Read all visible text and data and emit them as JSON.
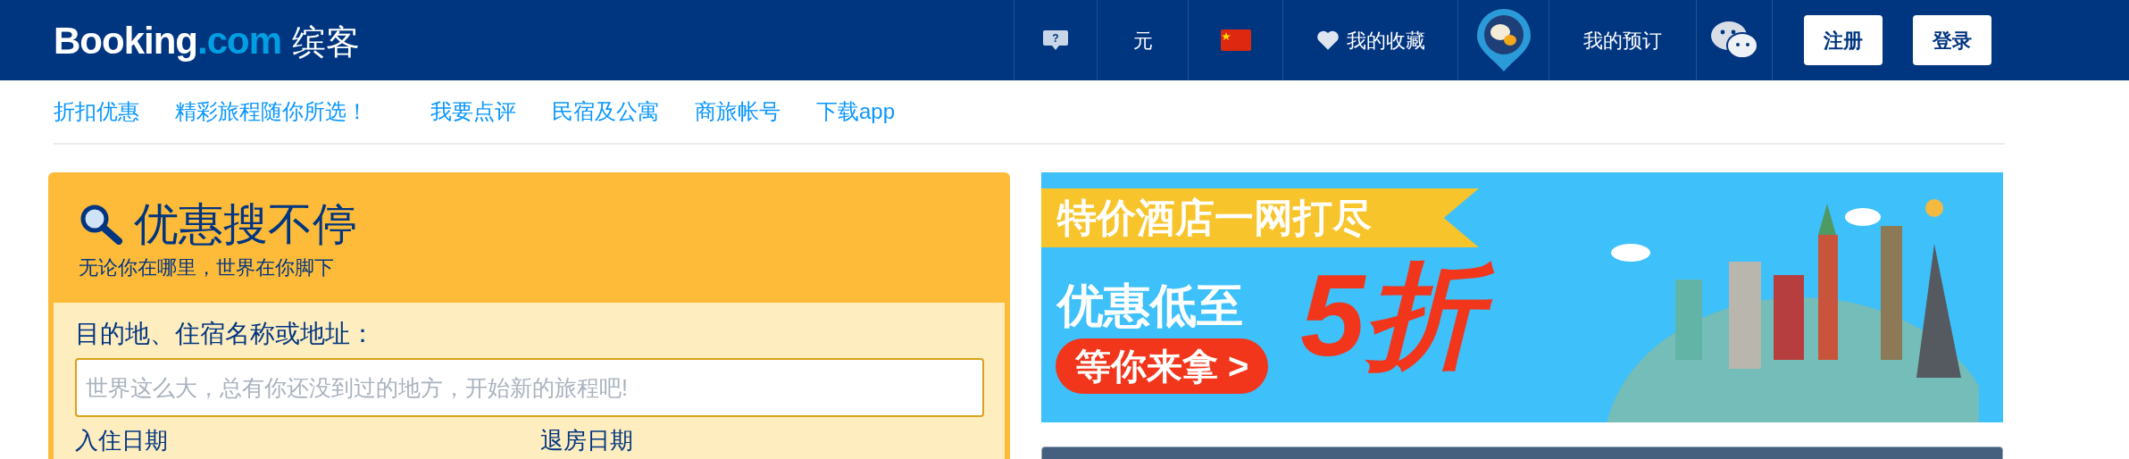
{
  "header": {
    "logo": {
      "brand": "Booking",
      "domain": ".com",
      "local_name": "缤客"
    },
    "items": [
      {
        "kind": "help-icon",
        "glyph": "?"
      },
      {
        "kind": "text",
        "label": "元"
      },
      {
        "kind": "flag"
      },
      {
        "kind": "heart",
        "label": "我的收藏"
      },
      {
        "kind": "chat-pin"
      },
      {
        "kind": "text",
        "label": "我的预订"
      },
      {
        "kind": "wechat"
      }
    ],
    "buttons": [
      "注册",
      "登录"
    ]
  },
  "nav": {
    "links": [
      "折扣优惠",
      "精彩旅程随你所选！",
      "我要点评",
      "民宿及公寓",
      "商旅帐号",
      "下载app"
    ]
  },
  "search": {
    "title": "优惠搜不停",
    "subtitle": "无论你在哪里，世界在你脚下",
    "destination_label": "目的地、住宿名称或地址：",
    "destination_placeholder": "世界这么大，总有你还没到过的地方，开始新的旅程吧!",
    "checkin_label": "入住日期",
    "checkout_label": "退房日期"
  },
  "banner": {
    "ribbon": "特价酒店一网打尽",
    "headline": "优惠低至",
    "discount": "5折",
    "cta": "等你来拿 >"
  }
}
